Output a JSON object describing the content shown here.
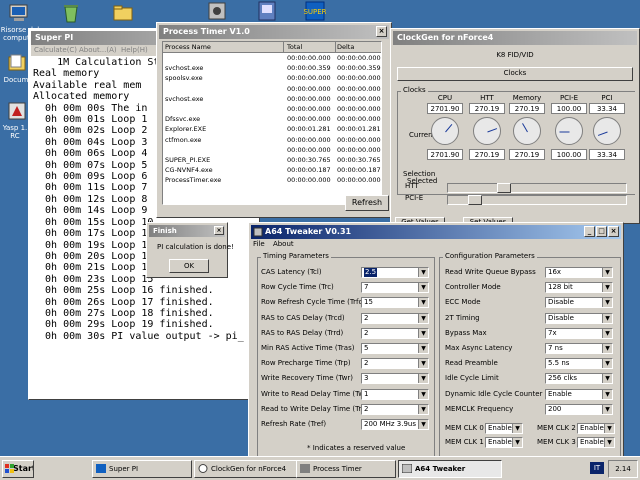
{
  "desktop": {
    "icons": [
      {
        "label": "Risorse del computer",
        "name": "my-computer-icon"
      },
      {
        "label": "Cestino",
        "name": "recycle-bin-icon"
      },
      {
        "label": "Docum",
        "name": "documents-icon"
      },
      {
        "label": "Yasp 1. RC",
        "name": "yasp-icon"
      }
    ]
  },
  "superpi": {
    "title": "Super PI",
    "menu": [
      "Calculate(C)",
      "About...(A)",
      "Help(H)"
    ],
    "lines": [
      "    1M Calculation St",
      "Real memory",
      "Available real mem",
      "Allocated memory",
      "  0h 00m 00s The in",
      "  0h 00m 01s Loop 1",
      "  0h 00m 02s Loop 2",
      "  0h 00m 04s Loop 3",
      "  0h 00m 06s Loop 4",
      "  0h 00m 07s Loop 5",
      "  0h 00m 09s Loop 6",
      "  0h 00m 11s Loop 7",
      "  0h 00m 12s Loop 8",
      "  0h 00m 14s Loop 9",
      "  0h 00m 15s Loop 10",
      "  0h 00m 17s Loop 11",
      "  0h 00m 19s Loop 12",
      "  0h 00m 20s Loop 13",
      "  0h 00m 21s Loop 14",
      "  0h 00m 23s Loop 15",
      "  0h 00m 25s Loop 16 finished.",
      "  0h 00m 26s Loop 17 finished.",
      "  0h 00m 27s Loop 18 finished.",
      "  0h 00m 29s Loop 19 finished.",
      "  0h 00m 30s PI value output -> pi_"
    ]
  },
  "process_timer": {
    "title": "Process Timer V1.0",
    "headers": [
      "Process Name",
      "Total",
      "Delta"
    ],
    "rows": [
      {
        "name": "",
        "total": "00:00:00.000",
        "delta": "00:00:00.000"
      },
      {
        "name": "svchost.exe",
        "total": "00:00:00.359",
        "delta": "00:00:00.359"
      },
      {
        "name": "spoolsv.exe",
        "total": "00:00:00.000",
        "delta": "00:00:00.000"
      },
      {
        "name": "",
        "total": "00:00:00.000",
        "delta": "00:00:00.000"
      },
      {
        "name": "svchost.exe",
        "total": "00:00:00.000",
        "delta": "00:00:00.000"
      },
      {
        "name": "",
        "total": "00:00:00.000",
        "delta": "00:00:00.000"
      },
      {
        "name": "Dfssvc.exe",
        "total": "00:00:00.000",
        "delta": "00:00:00.000"
      },
      {
        "name": "Explorer.EXE",
        "total": "00:00:01.281",
        "delta": "00:00:01.281"
      },
      {
        "name": "ctfmon.exe",
        "total": "00:00:00.000",
        "delta": "00:00:00.000"
      },
      {
        "name": "",
        "total": "00:00:00.000",
        "delta": "00:00:00.000"
      },
      {
        "name": "SUPER_PI.EXE",
        "total": "00:00:30.765",
        "delta": "00:00:30.765"
      },
      {
        "name": "CG-NVNF4.exe",
        "total": "00:00:00.187",
        "delta": "00:00:00.187"
      },
      {
        "name": "ProcessTimer.exe",
        "total": "00:00:00.000",
        "delta": "00:00:00.000"
      }
    ],
    "refresh_label": "Refresh"
  },
  "finish_dialog": {
    "title": "Finish",
    "message": "PI calculation is done!",
    "ok_label": "OK"
  },
  "clockgen": {
    "title": "ClockGen for nForce4",
    "board": "K8 FID/VID",
    "tab": "Clocks",
    "clocks_group": "Clocks",
    "columns": [
      "CPU",
      "HTT",
      "Memory",
      "PCI-E",
      "PCI"
    ],
    "current_label": "Current",
    "current": [
      "2701.90",
      "270.19",
      "270.19",
      "100.00",
      "33.34"
    ],
    "selected_label": "Selected",
    "selected": [
      "2701.90",
      "270.19",
      "270.19",
      "100.00",
      "33.34"
    ],
    "selection_group": "Selection",
    "htt_label": "HTT",
    "pcie_label": "PCI-E",
    "htt_level": 0.3,
    "pcie_level": 0.12,
    "buttons": [
      "Get Values",
      "Set Values"
    ]
  },
  "tweaker": {
    "title": "A64 Tweaker V0.31",
    "menu": [
      "File",
      "About"
    ],
    "timing_group": "Timing Parameters",
    "timings": [
      {
        "label": "CAS Latency (Tcl)",
        "value": "2.5"
      },
      {
        "label": "Row Cycle Time (Trc)",
        "value": "7"
      },
      {
        "label": "Row Refresh Cycle Time (Trfc)",
        "value": "15"
      },
      {
        "label": "RAS to CAS Delay (Trcd)",
        "value": "2"
      },
      {
        "label": "RAS to RAS Delay (Trrd)",
        "value": "2"
      },
      {
        "label": "Min RAS Active Time (Tras)",
        "value": "5"
      },
      {
        "label": "Row Precharge Time (Trp)",
        "value": "2"
      },
      {
        "label": "Write Recovery Time (Twr)",
        "value": "3"
      },
      {
        "label": "Write to Read Delay Time (Twtr)",
        "value": "1"
      },
      {
        "label": "Read to Write Delay Time (Trtw)",
        "value": "2"
      },
      {
        "label": "Refresh Rate (Tref)",
        "value": "200 MHz 3.9us"
      }
    ],
    "reserved_note": "* Indicates a reserved value",
    "config_group": "Configuration Parameters",
    "config": [
      {
        "label": "Read Write Queue Bypass",
        "value": "16x"
      },
      {
        "label": "Controller Mode",
        "value": "128 bit"
      },
      {
        "label": "ECC Mode",
        "value": "Disable"
      },
      {
        "label": "2T Timing",
        "value": "Disable"
      },
      {
        "label": "Bypass Max",
        "value": "7x"
      },
      {
        "label": "Max Async Latency",
        "value": "7 ns"
      },
      {
        "label": "Read Preamble",
        "value": "5.5 ns"
      },
      {
        "label": "Idle Cycle Limit",
        "value": "256 clks"
      },
      {
        "label": "Dynamic Idle Cycle Counter",
        "value": "Enable"
      },
      {
        "label": "MEMCLK Frequency",
        "value": "200"
      }
    ],
    "memclk": [
      {
        "label": "MEM CLK 0",
        "value": "Enable"
      },
      {
        "label": "MEM CLK 1",
        "value": "Enable"
      },
      {
        "label": "MEM CLK 2",
        "value": "Enable"
      },
      {
        "label": "MEM CLK 3",
        "value": "Enable"
      }
    ]
  },
  "taskbar": {
    "start_label": "Start",
    "tasks": [
      {
        "label": "Super PI"
      },
      {
        "label": "ClockGen for nForce4"
      },
      {
        "label": "Process Timer"
      },
      {
        "label": "A64 Tweaker"
      }
    ],
    "tray_lang": "IT",
    "clock": "2.14"
  }
}
